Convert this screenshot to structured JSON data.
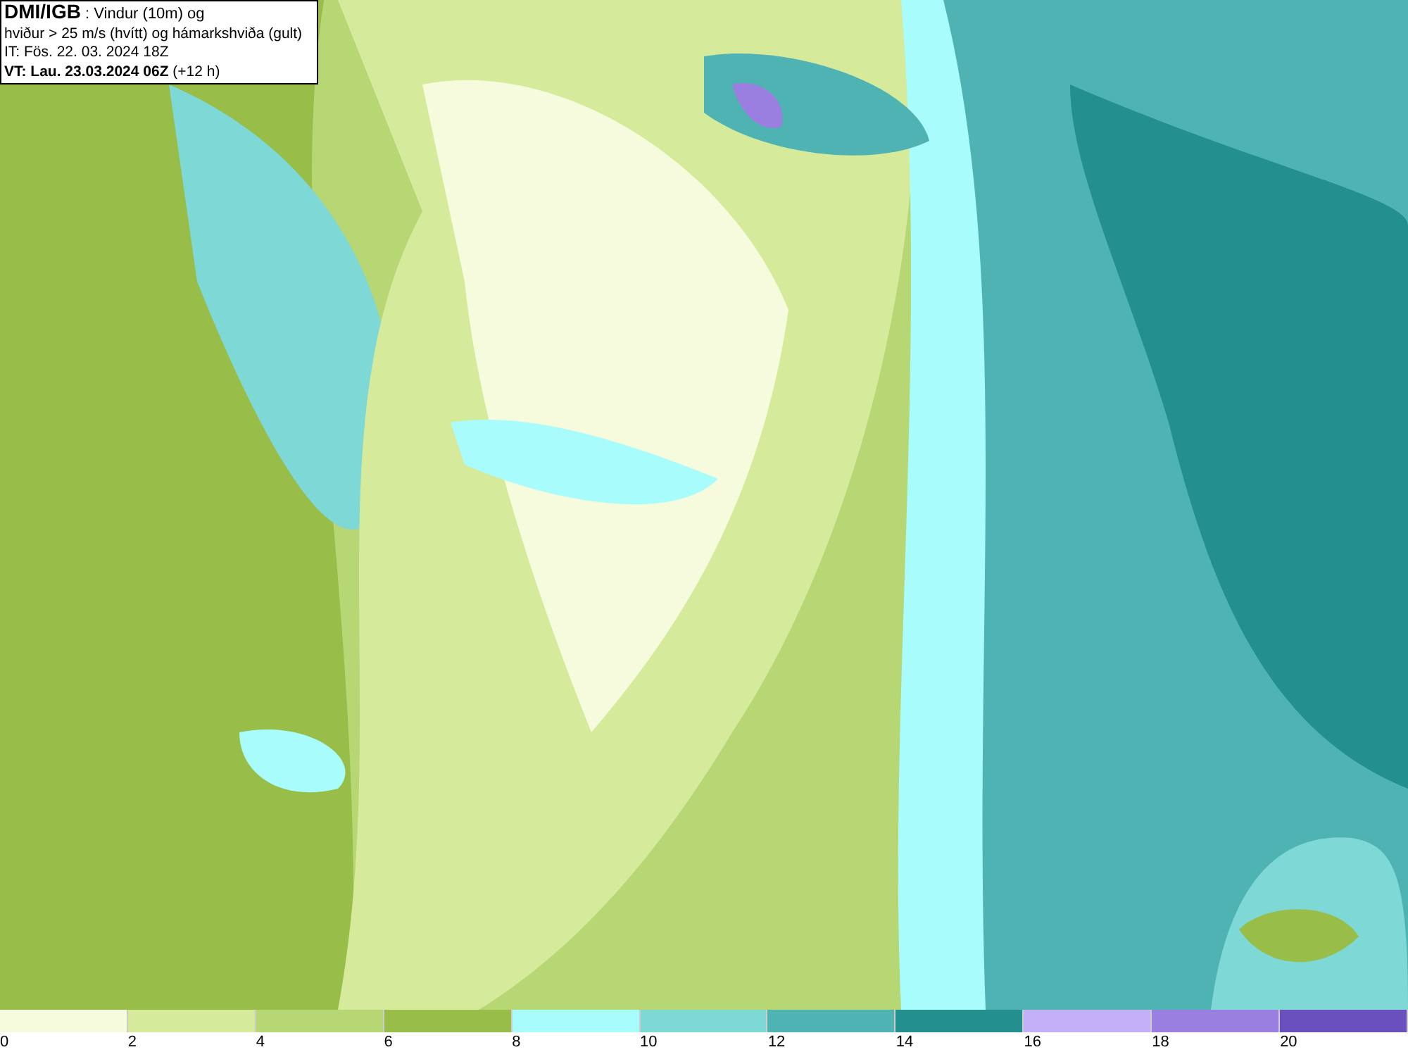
{
  "header": {
    "lines": [
      "**DMI/IGB** : Vindur (10m) og",
      "hviður > 25 m/s (hvítt) og hámarkshviða (gult)",
      "IT: Fös. 22. 03. 2024 18Z",
      "**VT: Lau. 23.03.2024 06Z** (+12 h)"
    ]
  },
  "legend": {
    "bins": [
      {
        "label": "0",
        "color": "#f5fbdc"
      },
      {
        "label": "2",
        "color": "#d5eb9b"
      },
      {
        "label": "4",
        "color": "#b6d774"
      },
      {
        "label": "6",
        "color": "#98bd48"
      },
      {
        "label": "8",
        "color": "#a8fcfc"
      },
      {
        "label": "10",
        "color": "#7dd8d6"
      },
      {
        "label": "12",
        "color": "#4fb3b3"
      },
      {
        "label": "14",
        "color": "#238f8f"
      },
      {
        "label": "16",
        "color": "#c4b0f8"
      },
      {
        "label": "18",
        "color": "#9b7fe0"
      },
      {
        "label": "20",
        "color": "#6a4fbf"
      }
    ]
  }
}
